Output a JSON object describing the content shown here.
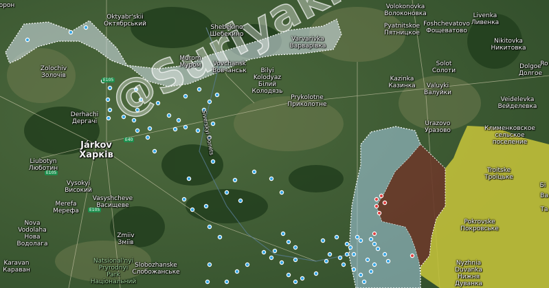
{
  "map": {
    "watermark": "@Suriyakmaps",
    "colors": {
      "grey_zone": "#c8d6dc",
      "blue_zone": "#a8cfe8",
      "brown_zone": "#6a3a2a",
      "yellow_zone": "#c4c23a",
      "marker_blue": "#35a7e8",
      "marker_red": "#e04040"
    },
    "places": [
      {
        "id": "oron",
        "text": "орон"
      },
      {
        "id": "oktyabrskii",
        "text": "Oktyabr'skii\nОктябрський"
      },
      {
        "id": "shebekino",
        "text": "Shebekino\nШебекино"
      },
      {
        "id": "volokonovka",
        "text": "Volokonovka\nВолоконовка"
      },
      {
        "id": "pyatnitskoe",
        "text": "Pyatnitskoe\nПятницкое"
      },
      {
        "id": "foshchevatovo",
        "text": "Foshchevatovo\nФощеватово"
      },
      {
        "id": "livenka",
        "text": "Livenka\nЛивенка"
      },
      {
        "id": "varvarivka",
        "text": "Varvarivka\nВарварівка"
      },
      {
        "id": "nikitovka",
        "text": "Nikitovka\nНикитовка"
      },
      {
        "id": "zolochiv",
        "text": "Zolochiv\nЗолочів"
      },
      {
        "id": "murom",
        "text": "Murom\nМуром"
      },
      {
        "id": "vovchansk",
        "text": "Vovchansk\nВовчанськ"
      },
      {
        "id": "solot",
        "text": "Solot\nСолоти"
      },
      {
        "id": "dolgoe",
        "text": "Dolgoe\nДолгое"
      },
      {
        "id": "biylyi",
        "text": "Bilyi\nKolodyaz\nБілий\nКолодязь"
      },
      {
        "id": "kazinka",
        "text": "Kazinka\nКазинка"
      },
      {
        "id": "valuyki",
        "text": "Valuyki\nВалуйки"
      },
      {
        "id": "prykolotne",
        "text": "Prykolotne\nПриколотне"
      },
      {
        "id": "veidelevka",
        "text": "Veidelevka\nВейделевка"
      },
      {
        "id": "derhachi",
        "text": "Derhachi\nДергачі"
      },
      {
        "id": "urazovo",
        "text": "Urazovo\nУразово"
      },
      {
        "id": "klimenkovskoe",
        "text": "Клименковское\nсельское\nпоселение"
      },
      {
        "id": "jarkov",
        "text": "Járkov\nХарків"
      },
      {
        "id": "liubotyn",
        "text": "Liubotyn\nЛюботин"
      },
      {
        "id": "troitske",
        "text": "Troitske\nТроїцьке"
      },
      {
        "id": "vysokyi",
        "text": "Vysokyi\nВисокий"
      },
      {
        "id": "vasyshcheve",
        "text": "Vasyshcheve\nВасищеве"
      },
      {
        "id": "merefa",
        "text": "Merefa\nМерефа"
      },
      {
        "id": "pokrovske",
        "text": "Pokrovske\nПокровське"
      },
      {
        "id": "nova_vodolaha",
        "text": "Nova\nVodolaha\nНова\nВодолага"
      },
      {
        "id": "zmiiv",
        "text": "Zmiiv\nЗміїв"
      },
      {
        "id": "karavan",
        "text": "Karavan\nКараван"
      },
      {
        "id": "natsionalnyi",
        "text": "Natsional'nyi\nPryrodnyi\nPark\nНаціональний"
      },
      {
        "id": "slobozhanske",
        "text": "Slobozhanske\nСлобожанське"
      },
      {
        "id": "nyzhnia_duvanka",
        "text": "Nyzhnia\nDuvanka\nНижня\nДуванка"
      },
      {
        "id": "bi",
        "text": "Бі"
      },
      {
        "id": "va",
        "text": "Ва"
      },
      {
        "id": "ro",
        "text": "Ro"
      },
      {
        "id": "ta",
        "text": "Та"
      }
    ],
    "river_label": "Siverskyi Donets",
    "roads": [
      {
        "id": "e105a",
        "text": "E105"
      },
      {
        "id": "e105b",
        "text": "E105"
      },
      {
        "id": "e40a",
        "text": "E40"
      },
      {
        "id": "e105c",
        "text": "E105"
      }
    ]
  }
}
